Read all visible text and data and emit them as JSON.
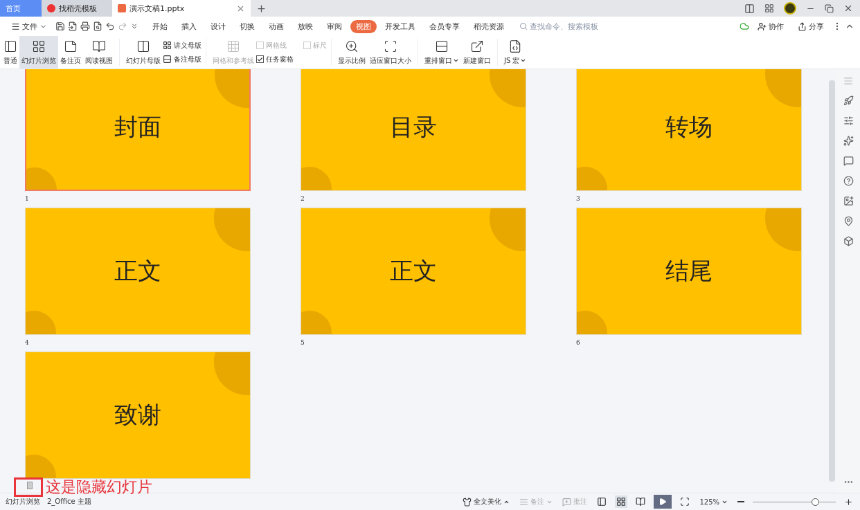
{
  "tabs": [
    {
      "label": "首页",
      "kind": "home",
      "selected": false
    },
    {
      "label": "找稻壳模板",
      "kind": "template",
      "selected": false
    },
    {
      "label": "演示文稿1.pptx",
      "kind": "document",
      "selected": true
    }
  ],
  "menu": {
    "file": "文件",
    "tabs": [
      {
        "label": "开始",
        "selected": false
      },
      {
        "label": "插入",
        "selected": false
      },
      {
        "label": "设计",
        "selected": false
      },
      {
        "label": "切换",
        "selected": false
      },
      {
        "label": "动画",
        "selected": false
      },
      {
        "label": "放映",
        "selected": false
      },
      {
        "label": "审阅",
        "selected": false
      },
      {
        "label": "视图",
        "selected": true
      },
      {
        "label": "开发工具",
        "selected": false
      },
      {
        "label": "会员专享",
        "selected": false
      },
      {
        "label": "稻壳资源",
        "selected": false
      }
    ],
    "search": {
      "placeholder": "查找命令、搜索模板"
    },
    "collaborate": "协作",
    "share": "分享"
  },
  "ribbon": {
    "views": [
      {
        "label": "普通",
        "selected": false
      },
      {
        "label": "幻灯片浏览",
        "selected": true
      },
      {
        "label": "备注页",
        "selected": false
      },
      {
        "label": "阅读视图",
        "selected": false
      }
    ],
    "slide_master": "幻灯片母版",
    "handout_master": "讲义母版",
    "notes_master": "备注母版",
    "grid_guides": {
      "label": "网格和参考线",
      "disabled": true
    },
    "checks": [
      {
        "label": "网格线",
        "checked": false,
        "disabled": true
      },
      {
        "label": "标尺",
        "checked": false,
        "disabled": true
      },
      {
        "label": "任务窗格",
        "checked": true,
        "disabled": false
      }
    ],
    "zoom": "显示比例",
    "fit_window": "适应窗口大小",
    "arrange": "重排窗口",
    "new_window": "新建窗口",
    "macro": "JS 宏"
  },
  "slides": [
    {
      "title": "封面",
      "number": "1",
      "selected": true,
      "hidden": false
    },
    {
      "title": "目录",
      "number": "2",
      "selected": false,
      "hidden": false
    },
    {
      "title": "转场",
      "number": "3",
      "selected": false,
      "hidden": false
    },
    {
      "title": "正文",
      "number": "4",
      "selected": false,
      "hidden": false
    },
    {
      "title": "正文",
      "number": "5",
      "selected": false,
      "hidden": false
    },
    {
      "title": "结尾",
      "number": "6",
      "selected": false,
      "hidden": false
    },
    {
      "title": "致谢",
      "selected": false,
      "hidden": true
    }
  ],
  "annotation": "这是隐藏幻灯片",
  "status_bar": {
    "view": "幻灯片浏览",
    "theme": "2_Office 主题",
    "beautify": "全文美化",
    "notes": "备注",
    "comments": "批注",
    "zoom": "125%",
    "zoom_slider": {
      "level": 0.75
    }
  }
}
